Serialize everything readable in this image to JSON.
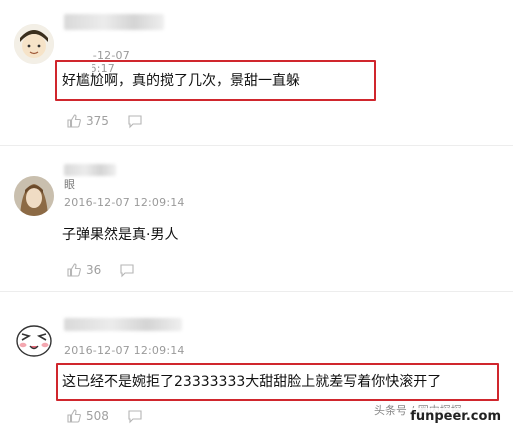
{
  "comments": [
    {
      "time": "2016-12-07 12:06:17",
      "text": "好尴尬啊，真的搅了几次，景甜一直躲",
      "likes": "375"
    },
    {
      "name_fragment": "眼",
      "time": "2016-12-07 12:09:14",
      "text": "子弹果然是真·男人",
      "likes": "36"
    },
    {
      "time": "2016-12-07 12:09:14",
      "text": "这已经不是婉拒了23333333大甜甜脸上就差写着你快滚开了",
      "likes": "508"
    }
  ],
  "watermark": "funpeer.com",
  "source_tag": "头条号 / 圈内探探",
  "colors": {
    "highlight": "#d0262d",
    "meta": "#9a9a9a"
  },
  "icons": [
    "thumbs-up-icon",
    "reply-icon"
  ]
}
